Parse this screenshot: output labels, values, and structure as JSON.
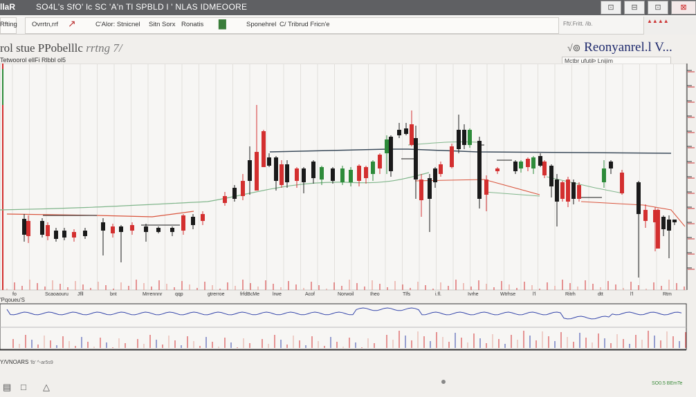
{
  "window": {
    "logo": "llaR",
    "title": "SO4L's SfO' lc SC 'A'n  Tl  SPBLD  l  '  NLAS IDMEOORE",
    "buttons": [
      "⊡",
      "⊟",
      "⊡",
      "⊠"
    ]
  },
  "toolbar": {
    "items": [
      {
        "label": "Rfting",
        "icon": ""
      },
      {
        "label": "Ovrrtn,rrf",
        "icon": "chart-line-icon"
      },
      {
        "label": "C'Alor: Stnicnel",
        "icon": ""
      },
      {
        "label": "Sitn Sorx",
        "icon": ""
      },
      {
        "label": "Ronatis",
        "icon": "bar-chart-icon"
      },
      {
        "label": "Sponehrel",
        "icon": ""
      },
      {
        "label": "C/ Tribrud Fricn'e",
        "icon": ""
      }
    ],
    "right_tabs": "Fft/.Fritt. /ib."
  },
  "heading": {
    "left": "rol  stue PPobelllc",
    "left_italic": "rrtng 7/",
    "right_arrow": "√⊚",
    "right": "Reonyanrel.l V..."
  },
  "subrow": {
    "left": "Tetwoorol ellFi Rlbbl ol5",
    "right": "Mctbr ufutiÞ Lnijim"
  },
  "chart_data": {
    "type": "candlestick",
    "title": "",
    "y_ticks": [
      "",
      "",
      "",
      "",
      "",
      "",
      "",
      "",
      "",
      "",
      "",
      "",
      "",
      ""
    ],
    "x_tick_labels": [
      "fo",
      "Scaoaouru",
      "Jfll",
      "bnt",
      "Mrrennnr",
      "qqp",
      "gtrerroe",
      "frfdBcMe",
      "lrwe",
      "Acof",
      "Norwoil",
      "Iheo",
      "Tlfs",
      "i.fl.",
      "Ivrhe",
      "Wtrhse",
      "l'l",
      "Ritrh",
      "dtt",
      "l'l",
      "Rtm"
    ],
    "colors": {
      "up": "#d32f2f",
      "down": "#1a1a1a",
      "green": "#2e8b3a",
      "ma_green": "#7fb58a",
      "ma_dark": "#3a4a5a",
      "ma_red": "#d9533b",
      "osc": "#3344aa"
    }
  },
  "indicator": {
    "label": "'Pqoueu'S",
    "footer": "Y/VNOARS",
    "footer_small": "'lb' ^‑ar5s9"
  },
  "statusbar": {
    "text": "SO0.5 BEmTe",
    "icons": [
      "print-icon",
      "chat-icon",
      "warning-icon"
    ]
  }
}
